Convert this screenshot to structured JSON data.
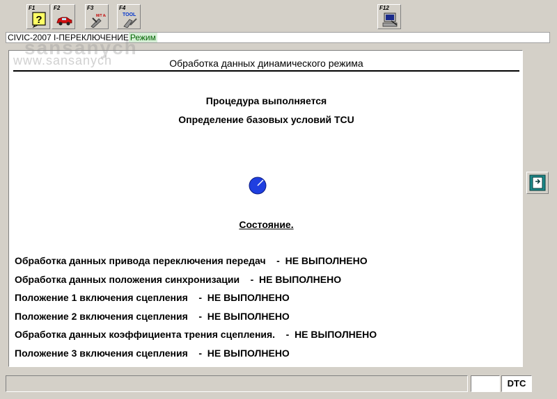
{
  "toolbar": {
    "f1": {
      "key": "F1",
      "icon": "help-question-icon"
    },
    "f2": {
      "key": "F2",
      "icon": "car-icon"
    },
    "f3": {
      "key": "F3",
      "icon": "mt-at-tool-icon",
      "glyph": "M/T  A/T"
    },
    "f4": {
      "key": "F4",
      "icon": "tool-icon",
      "glyph": "TOOL"
    },
    "f12": {
      "key": "F12",
      "icon": "computer-icon"
    }
  },
  "breadcrumb": {
    "path": "CIVIC-2007 I-ПЕРЕКЛЮЧЕНИЕ",
    "mode": "Режим"
  },
  "panel": {
    "title": "Обработка данных динамического режима",
    "watermark_logo": "sansanych",
    "watermark_url": "www.sansanych",
    "procedure_line": "Процедура выполняется",
    "condition_line": "Определение базовых условий TCU",
    "status_heading": "Состояние.",
    "status_rows": [
      {
        "label": "Обработка данных привода переключения передач",
        "value": "-  НЕ ВЫПОЛНЕНО"
      },
      {
        "label": "Обработка данных положения синхронизации",
        "value": "-  НЕ ВЫПОЛНЕНО"
      },
      {
        "label": "Положение 1 включения сцепления",
        "value": "-  НЕ ВЫПОЛНЕНО"
      },
      {
        "label": "Положение 2 включения сцепления",
        "value": "-  НЕ ВЫПОЛНЕНО"
      },
      {
        "label": "Обработка данных коэффициента трения сцепления.",
        "value": "-  НЕ ВЫПОЛНЕНО"
      },
      {
        "label": "Положение 3 включения сцепления",
        "value": "-  НЕ ВЫПОЛНЕНО"
      }
    ]
  },
  "side": {
    "exit_icon": "exit-door-icon"
  },
  "statusbar": {
    "dtc_label": "DTC",
    "status_text": "",
    "box_value": ""
  },
  "colors": {
    "spinner": "#1f3fe0",
    "mode_bg": "#d6efd6",
    "window_bg": "#d4d0c8"
  }
}
